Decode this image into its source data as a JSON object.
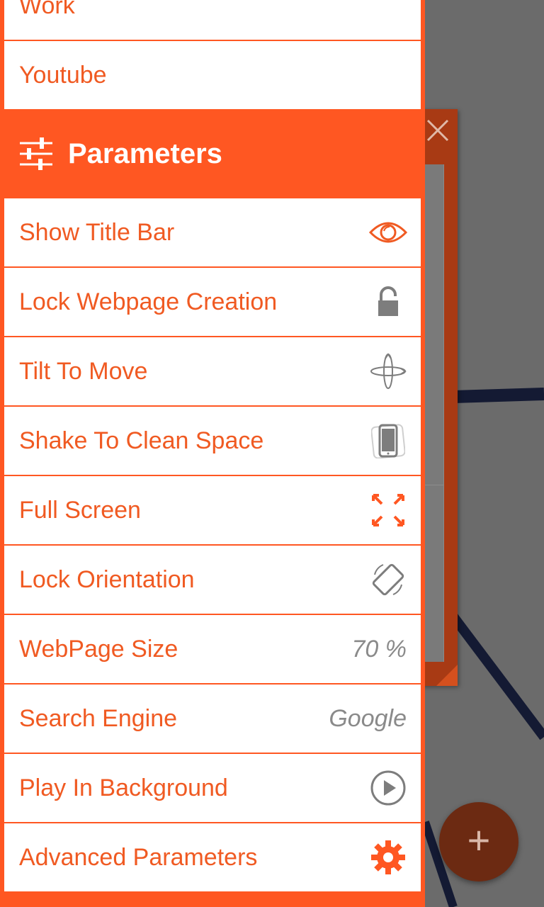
{
  "groups": {
    "items": [
      {
        "label": "Work"
      },
      {
        "label": "Youtube"
      }
    ]
  },
  "parameters": {
    "title": "Parameters",
    "items": [
      {
        "label": "Show Title Bar",
        "icon": "eye-icon"
      },
      {
        "label": "Lock Webpage Creation",
        "icon": "lock-icon"
      },
      {
        "label": "Tilt To Move",
        "icon": "tilt-icon"
      },
      {
        "label": "Shake To Clean Space",
        "icon": "shake-phone-icon"
      },
      {
        "label": "Full Screen",
        "icon": "fullscreen-icon"
      },
      {
        "label": "Lock Orientation",
        "icon": "screen-rotation-icon"
      },
      {
        "label": "WebPage Size",
        "value": "70 %"
      },
      {
        "label": "Search Engine",
        "value": "Google"
      },
      {
        "label": "Play In Background",
        "icon": "play-circle-icon"
      },
      {
        "label": "Advanced Parameters",
        "icon": "gear-icon"
      }
    ]
  },
  "fab": {
    "label": "+"
  },
  "colors": {
    "accent": "#ff5722",
    "label_text": "#f05a22",
    "muted_icon": "#8a8a8a",
    "overlay": "#6b6b6b",
    "line": "#141a33"
  }
}
